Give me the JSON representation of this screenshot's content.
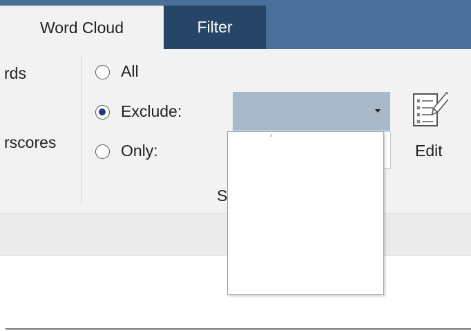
{
  "tabs": {
    "word_cloud": "Word Cloud",
    "filter": "Filter"
  },
  "left_group": {
    "words_label_partial": "rds",
    "underscores_label_partial": "rscores"
  },
  "filter_group": {
    "options": {
      "all": "All",
      "exclude": "Exclude:",
      "only": "Only:"
    },
    "selected_option": "exclude",
    "dropdown_value": "",
    "group_label_partial": "S"
  },
  "edit_button": {
    "label": "Edit",
    "icon": "edit-list-icon"
  },
  "colors": {
    "tab_bar": "#4a7099",
    "active_tab": "#274566",
    "dropdown_fill": "#a9b9c9",
    "ribbon": "#f2f2f2"
  }
}
